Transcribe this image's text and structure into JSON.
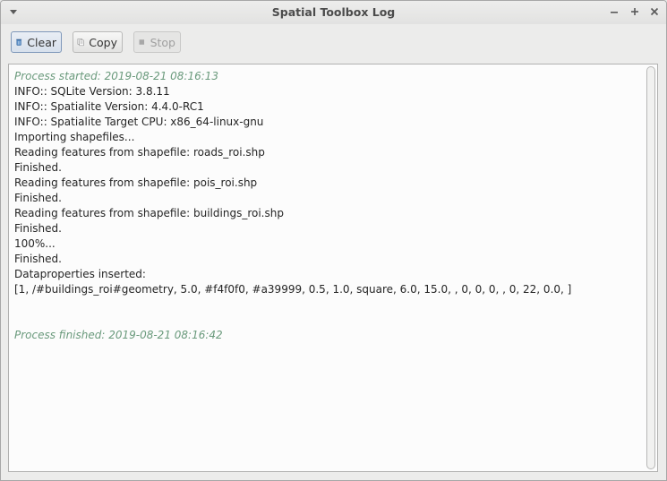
{
  "window": {
    "title": "Spatial Toolbox Log",
    "controls": [
      "minimize",
      "maximize",
      "close"
    ]
  },
  "toolbar": {
    "clear_label": "Clear",
    "copy_label": "Copy",
    "stop_label": "Stop",
    "clear_icon": "trash-icon",
    "copy_icon": "copy-icon",
    "stop_icon": "stop-icon",
    "stop_enabled": false
  },
  "log": {
    "lines": [
      {
        "text": "Process started: 2019-08-21 08:16:13",
        "style": "status"
      },
      {
        "text": "INFO:: SQLite Version: 3.8.11",
        "style": "normal"
      },
      {
        "text": "INFO:: Spatialite Version: 4.4.0-RC1",
        "style": "normal"
      },
      {
        "text": "INFO:: Spatialite Target CPU: x86_64-linux-gnu",
        "style": "normal"
      },
      {
        "text": "Importing shapefiles...",
        "style": "normal"
      },
      {
        "text": "Reading features from shapefile: roads_roi.shp",
        "style": "normal"
      },
      {
        "text": "Finished.",
        "style": "normal"
      },
      {
        "text": "Reading features from shapefile: pois_roi.shp",
        "style": "normal"
      },
      {
        "text": "Finished.",
        "style": "normal"
      },
      {
        "text": "Reading features from shapefile: buildings_roi.shp",
        "style": "normal"
      },
      {
        "text": "Finished.",
        "style": "normal"
      },
      {
        "text": "100%...",
        "style": "normal"
      },
      {
        "text": "Finished.",
        "style": "normal"
      },
      {
        "text": "Dataproperties inserted:",
        "style": "normal"
      },
      {
        "text": "[1, /#buildings_roi#geometry, 5.0, #f4f0f0, #a39999, 0.5, 1.0, square, 6.0, 15.0, , 0, 0, 0, , 0, 22, 0.0, ]",
        "style": "normal"
      },
      {
        "text": "",
        "style": "normal"
      },
      {
        "text": "",
        "style": "normal"
      },
      {
        "text": "Process finished: 2019-08-21 08:16:42",
        "style": "status"
      }
    ]
  },
  "colors": {
    "status_text": "#6a9a7c",
    "log_background": "#fcfcfc",
    "window_background": "#ececeb"
  }
}
